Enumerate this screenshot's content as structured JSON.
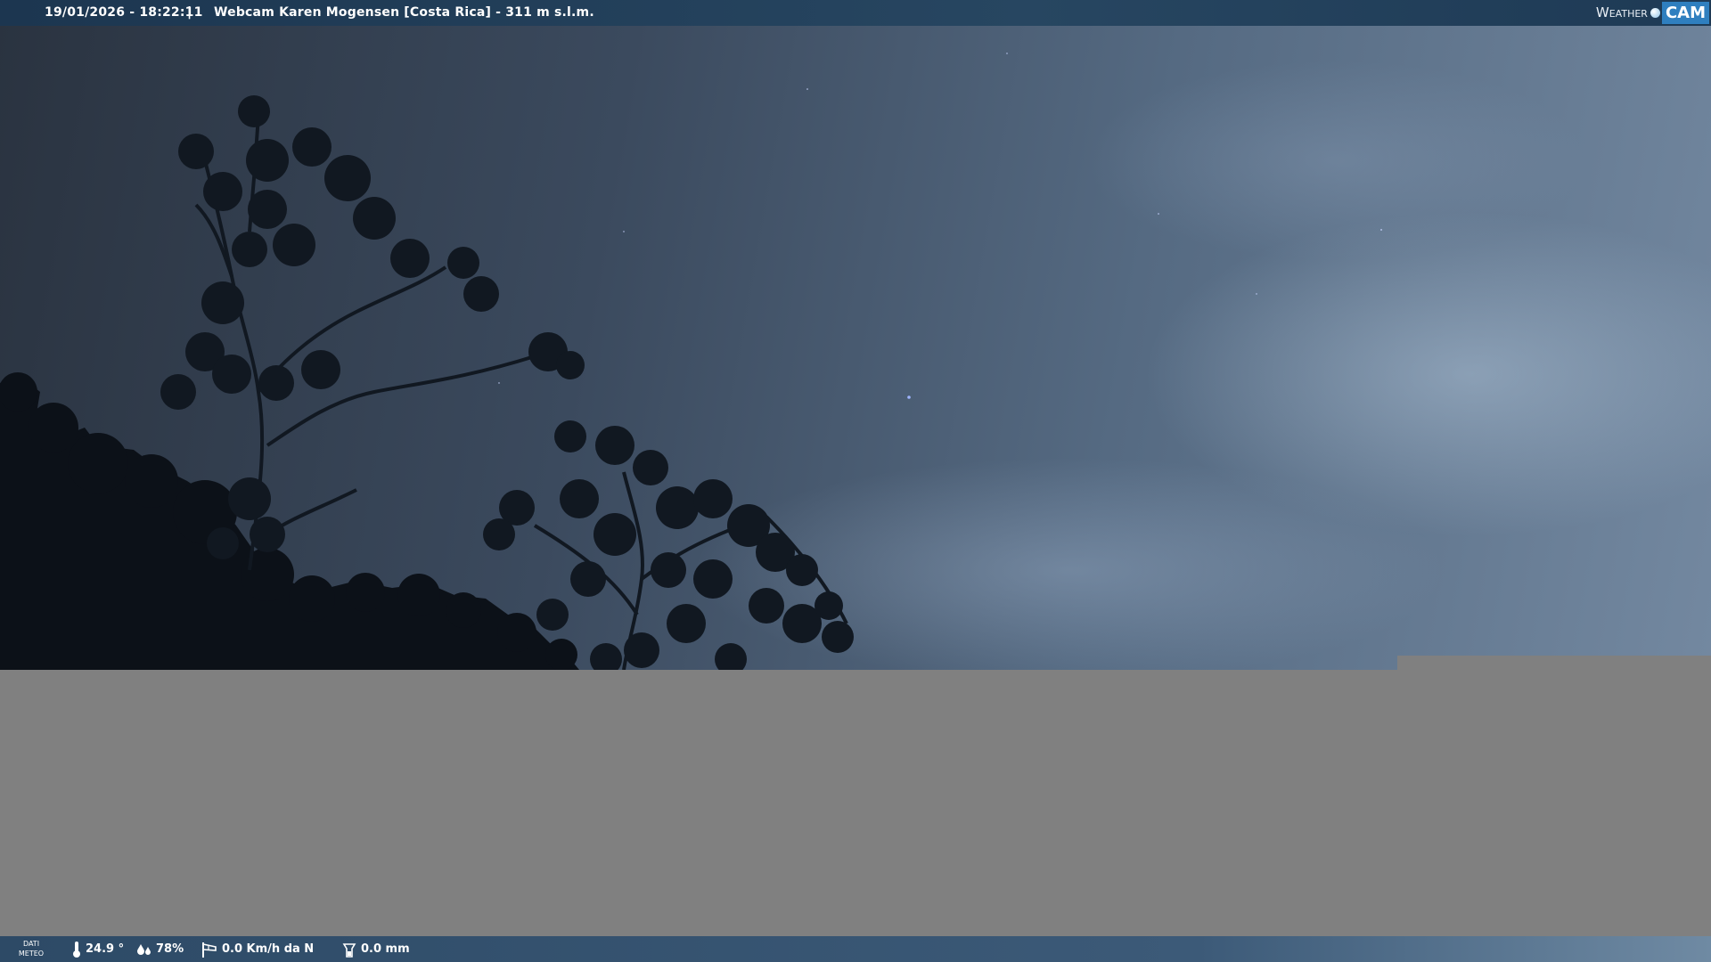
{
  "overlay": {
    "timestamp": "19/01/2026 - 18:22:11",
    "separator": "|",
    "camera_title": "Webcam Karen Mogensen [Costa Rica]  - 311 m s.l.m."
  },
  "logo": {
    "weather_text": "Weather",
    "cam_text": "CAM"
  },
  "weather_bar": {
    "label_line1": "DATI",
    "label_line2": "METEO",
    "temperature": "24.9 °",
    "humidity": "78%",
    "wind": "0.0 Km/h da N",
    "rain": "0.0 mm",
    "icons": [
      "thermometer-icon",
      "humidity-drops-icon",
      "wind-sock-icon",
      "rain-gauge-icon"
    ]
  },
  "colors": {
    "top_bar": "#274661",
    "bottom_bar": "#3c5a78",
    "logo_accent": "#2f7fbf",
    "placeholder_gray": "#808080"
  }
}
